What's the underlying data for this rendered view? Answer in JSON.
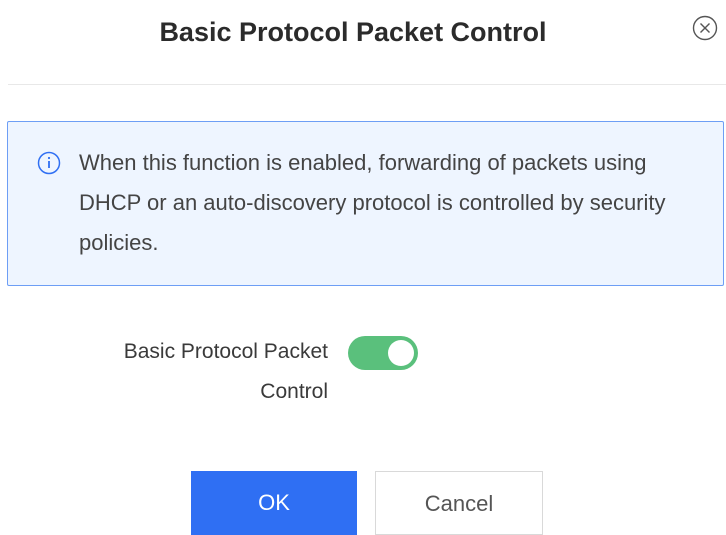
{
  "dialog": {
    "title": "Basic Protocol Packet Control",
    "close_icon": "close-circle-icon"
  },
  "info": {
    "icon": "info-circle-icon",
    "text": "When this function is enabled, forwarding of packets using DHCP or an auto-discovery protocol is controlled by security policies."
  },
  "form": {
    "label": "Basic Protocol Packet Control",
    "toggle_enabled": true,
    "toggle_color": "#5ac07c"
  },
  "buttons": {
    "ok_label": "OK",
    "cancel_label": "Cancel",
    "ok_color": "#2f6ff3"
  }
}
